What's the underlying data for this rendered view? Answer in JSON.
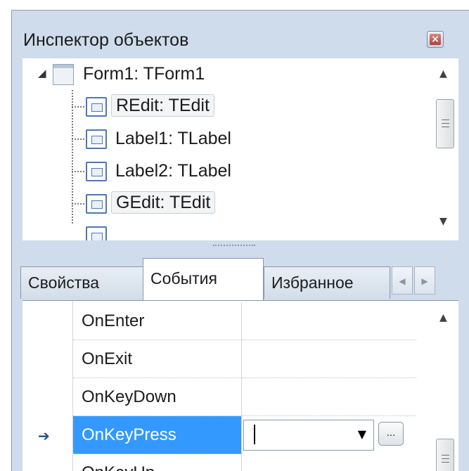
{
  "window": {
    "title": "Инспектор объектов",
    "close_label": "×"
  },
  "tree": {
    "root": {
      "label": "Form1: TForm1",
      "expander": "◢"
    },
    "items": [
      {
        "label": "REdit: TEdit"
      },
      {
        "label": "Label1: TLabel"
      },
      {
        "label": "Label2: TLabel"
      },
      {
        "label": "GEdit: TEdit"
      }
    ],
    "scroll_up": "▲",
    "scroll_down": "▼"
  },
  "tabs": [
    {
      "label": "Свойства",
      "active": false
    },
    {
      "label": "События",
      "active": true
    },
    {
      "label": "Избранное",
      "active": false
    }
  ],
  "tab_nav": {
    "left": "◀",
    "right": "▶"
  },
  "events": {
    "rows": [
      {
        "name": "OnEnter",
        "value": ""
      },
      {
        "name": "OnExit",
        "value": ""
      },
      {
        "name": "OnKeyDown",
        "value": ""
      },
      {
        "name": "OnKeyPress",
        "value": "",
        "selected": true
      },
      {
        "name": "OnKeyUp",
        "value": ""
      }
    ],
    "row_marker": "➔",
    "combo_arrow": "▼",
    "ellipsis_label": "...",
    "scroll_up": "▲"
  },
  "icons": {
    "form": "form-icon",
    "component": "edit-component-icon",
    "close": "close-icon"
  },
  "colors": {
    "window_bg": "#cfdceb",
    "selection": "#3399ff",
    "close_red": "#b0423c"
  }
}
